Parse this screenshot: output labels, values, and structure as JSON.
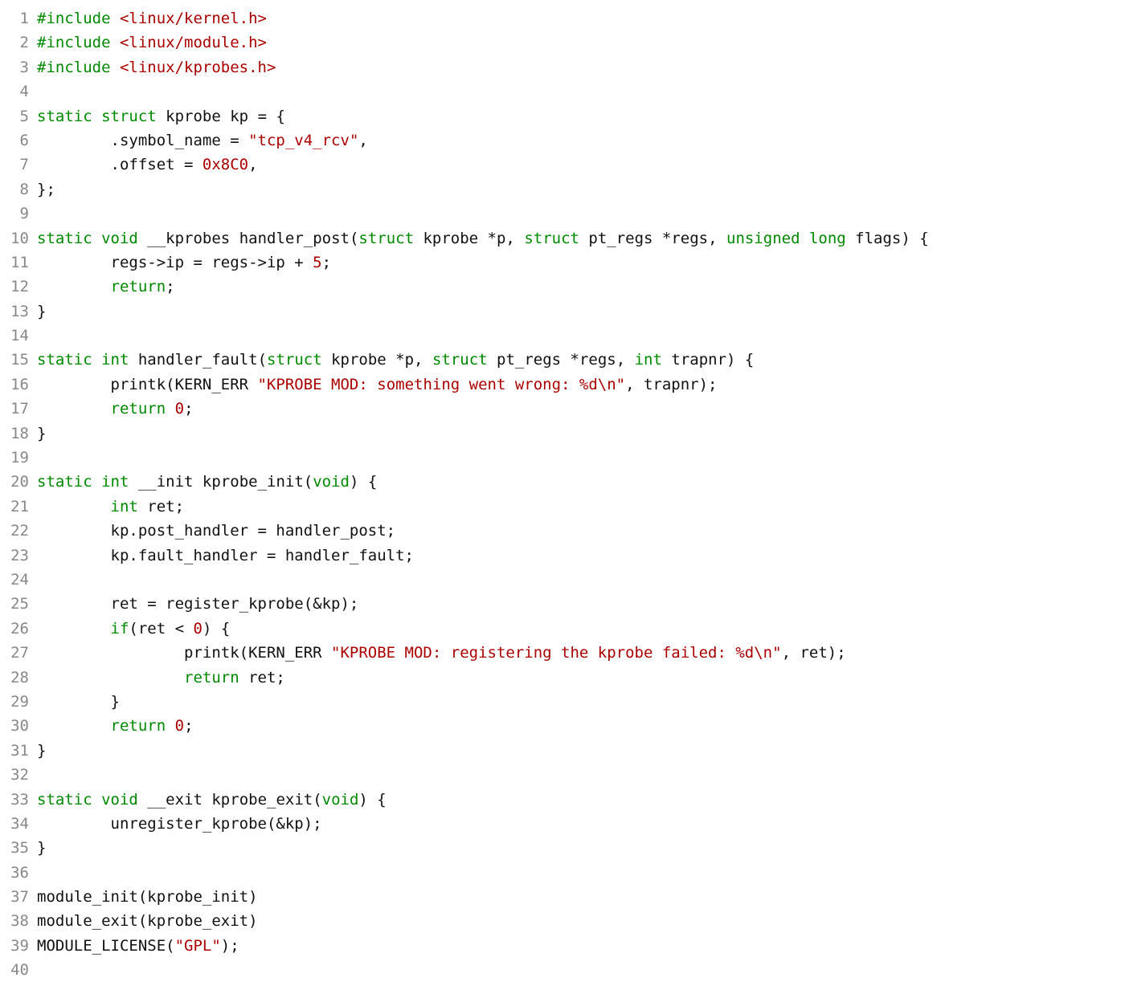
{
  "code": {
    "lines": [
      {
        "n": "1",
        "tokens": [
          [
            "pp",
            "#include "
          ],
          [
            "inc",
            "<linux/kernel.h>"
          ]
        ]
      },
      {
        "n": "2",
        "tokens": [
          [
            "pp",
            "#include "
          ],
          [
            "inc",
            "<linux/module.h>"
          ]
        ]
      },
      {
        "n": "3",
        "tokens": [
          [
            "pp",
            "#include "
          ],
          [
            "inc",
            "<linux/kprobes.h>"
          ]
        ]
      },
      {
        "n": "4",
        "tokens": []
      },
      {
        "n": "5",
        "tokens": [
          [
            "kw",
            "static"
          ],
          [
            "id",
            " "
          ],
          [
            "kw",
            "struct"
          ],
          [
            "id",
            " kprobe kp = {"
          ]
        ]
      },
      {
        "n": "6",
        "tokens": [
          [
            "id",
            "        .symbol_name = "
          ],
          [
            "str",
            "\"tcp_v4_rcv\""
          ],
          [
            "id",
            ","
          ]
        ]
      },
      {
        "n": "7",
        "tokens": [
          [
            "id",
            "        .offset = "
          ],
          [
            "num",
            "0x8C0"
          ],
          [
            "id",
            ","
          ]
        ]
      },
      {
        "n": "8",
        "tokens": [
          [
            "id",
            "};"
          ]
        ]
      },
      {
        "n": "9",
        "tokens": []
      },
      {
        "n": "10",
        "tokens": [
          [
            "kw",
            "static"
          ],
          [
            "id",
            " "
          ],
          [
            "kw",
            "void"
          ],
          [
            "id",
            " __kprobes handler_post("
          ],
          [
            "kw",
            "struct"
          ],
          [
            "id",
            " kprobe *p, "
          ],
          [
            "kw",
            "struct"
          ],
          [
            "id",
            " pt_regs *regs, "
          ],
          [
            "kw",
            "unsigned"
          ],
          [
            "id",
            " "
          ],
          [
            "kw",
            "long"
          ],
          [
            "id",
            " flags) {"
          ]
        ]
      },
      {
        "n": "11",
        "tokens": [
          [
            "id",
            "        regs->ip = regs->ip + "
          ],
          [
            "num",
            "5"
          ],
          [
            "id",
            ";"
          ]
        ]
      },
      {
        "n": "12",
        "tokens": [
          [
            "id",
            "        "
          ],
          [
            "kw",
            "return"
          ],
          [
            "id",
            ";"
          ]
        ]
      },
      {
        "n": "13",
        "tokens": [
          [
            "id",
            "}"
          ]
        ]
      },
      {
        "n": "14",
        "tokens": []
      },
      {
        "n": "15",
        "tokens": [
          [
            "kw",
            "static"
          ],
          [
            "id",
            " "
          ],
          [
            "kw",
            "int"
          ],
          [
            "id",
            " handler_fault("
          ],
          [
            "kw",
            "struct"
          ],
          [
            "id",
            " kprobe *p, "
          ],
          [
            "kw",
            "struct"
          ],
          [
            "id",
            " pt_regs *regs, "
          ],
          [
            "kw",
            "int"
          ],
          [
            "id",
            " trapnr) {"
          ]
        ]
      },
      {
        "n": "16",
        "tokens": [
          [
            "id",
            "        printk(KERN_ERR "
          ],
          [
            "str",
            "\"KPROBE MOD: something went wrong: %d\\n\""
          ],
          [
            "id",
            ", trapnr);"
          ]
        ]
      },
      {
        "n": "17",
        "tokens": [
          [
            "id",
            "        "
          ],
          [
            "kw",
            "return"
          ],
          [
            "id",
            " "
          ],
          [
            "num",
            "0"
          ],
          [
            "id",
            ";"
          ]
        ]
      },
      {
        "n": "18",
        "tokens": [
          [
            "id",
            "}"
          ]
        ]
      },
      {
        "n": "19",
        "tokens": []
      },
      {
        "n": "20",
        "tokens": [
          [
            "kw",
            "static"
          ],
          [
            "id",
            " "
          ],
          [
            "kw",
            "int"
          ],
          [
            "id",
            " __init kprobe_init("
          ],
          [
            "kw",
            "void"
          ],
          [
            "id",
            ") {"
          ]
        ]
      },
      {
        "n": "21",
        "tokens": [
          [
            "id",
            "        "
          ],
          [
            "kw",
            "int"
          ],
          [
            "id",
            " ret;"
          ]
        ]
      },
      {
        "n": "22",
        "tokens": [
          [
            "id",
            "        kp.post_handler = handler_post;"
          ]
        ]
      },
      {
        "n": "23",
        "tokens": [
          [
            "id",
            "        kp.fault_handler = handler_fault;"
          ]
        ]
      },
      {
        "n": "24",
        "tokens": []
      },
      {
        "n": "25",
        "tokens": [
          [
            "id",
            "        ret = register_kprobe(&kp);"
          ]
        ]
      },
      {
        "n": "26",
        "tokens": [
          [
            "id",
            "        "
          ],
          [
            "kw",
            "if"
          ],
          [
            "id",
            "(ret < "
          ],
          [
            "num",
            "0"
          ],
          [
            "id",
            ") {"
          ]
        ]
      },
      {
        "n": "27",
        "tokens": [
          [
            "id",
            "                printk(KERN_ERR "
          ],
          [
            "str",
            "\"KPROBE MOD: registering the kprobe failed: %d\\n\""
          ],
          [
            "id",
            ", ret);"
          ]
        ]
      },
      {
        "n": "28",
        "tokens": [
          [
            "id",
            "                "
          ],
          [
            "kw",
            "return"
          ],
          [
            "id",
            " ret;"
          ]
        ]
      },
      {
        "n": "29",
        "tokens": [
          [
            "id",
            "        }"
          ]
        ]
      },
      {
        "n": "30",
        "tokens": [
          [
            "id",
            "        "
          ],
          [
            "kw",
            "return"
          ],
          [
            "id",
            " "
          ],
          [
            "num",
            "0"
          ],
          [
            "id",
            ";"
          ]
        ]
      },
      {
        "n": "31",
        "tokens": [
          [
            "id",
            "}"
          ]
        ]
      },
      {
        "n": "32",
        "tokens": []
      },
      {
        "n": "33",
        "tokens": [
          [
            "kw",
            "static"
          ],
          [
            "id",
            " "
          ],
          [
            "kw",
            "void"
          ],
          [
            "id",
            " __exit kprobe_exit("
          ],
          [
            "kw",
            "void"
          ],
          [
            "id",
            ") {"
          ]
        ]
      },
      {
        "n": "34",
        "tokens": [
          [
            "id",
            "        unregister_kprobe(&kp);"
          ]
        ]
      },
      {
        "n": "35",
        "tokens": [
          [
            "id",
            "}"
          ]
        ]
      },
      {
        "n": "36",
        "tokens": []
      },
      {
        "n": "37",
        "tokens": [
          [
            "id",
            "module_init(kprobe_init)"
          ]
        ]
      },
      {
        "n": "38",
        "tokens": [
          [
            "id",
            "module_exit(kprobe_exit)"
          ]
        ]
      },
      {
        "n": "39",
        "tokens": [
          [
            "id",
            "MODULE_LICENSE("
          ],
          [
            "str",
            "\"GPL\""
          ],
          [
            "id",
            ");"
          ]
        ]
      },
      {
        "n": "40",
        "tokens": []
      }
    ]
  }
}
